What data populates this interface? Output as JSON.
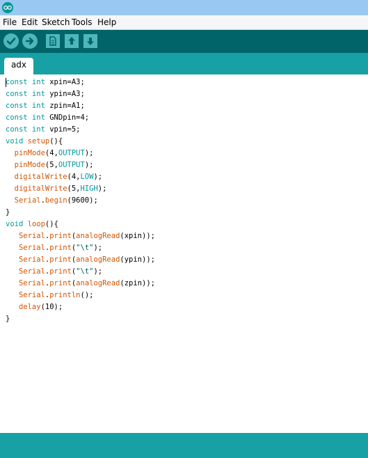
{
  "menu": [
    "File",
    "Edit",
    "Sketch",
    "Tools",
    "Help"
  ],
  "toolbar": {
    "verify_icon": "check-icon",
    "upload_icon": "arrow-right-icon",
    "new_icon": "file-icon",
    "open_icon": "arrow-up-icon",
    "save_icon": "arrow-down-icon"
  },
  "tabs": [
    {
      "label": "adx"
    }
  ],
  "code": [
    [
      {
        "t": "const int",
        "c": "kw"
      },
      {
        "t": " xpin=A3;",
        "c": ""
      }
    ],
    [
      {
        "t": "const int",
        "c": "kw"
      },
      {
        "t": " ypin=A3;",
        "c": ""
      }
    ],
    [
      {
        "t": "const int",
        "c": "kw"
      },
      {
        "t": " zpin=A1;",
        "c": ""
      }
    ],
    [
      {
        "t": "const int",
        "c": "kw"
      },
      {
        "t": " GNDpin=4;",
        "c": ""
      }
    ],
    [
      {
        "t": "const int",
        "c": "kw"
      },
      {
        "t": " vpin=5;",
        "c": ""
      }
    ],
    [
      {
        "t": "void",
        "c": "kw"
      },
      {
        "t": " ",
        "c": ""
      },
      {
        "t": "setup",
        "c": "fn"
      },
      {
        "t": "(){",
        "c": ""
      }
    ],
    [
      {
        "t": "  ",
        "c": ""
      },
      {
        "t": "pinMode",
        "c": "fn"
      },
      {
        "t": "(4,",
        "c": ""
      },
      {
        "t": "OUTPUT",
        "c": "kw"
      },
      {
        "t": ");",
        "c": ""
      }
    ],
    [
      {
        "t": "  ",
        "c": ""
      },
      {
        "t": "pinMode",
        "c": "fn"
      },
      {
        "t": "(5,",
        "c": ""
      },
      {
        "t": "OUTPUT",
        "c": "kw"
      },
      {
        "t": ");",
        "c": ""
      }
    ],
    [
      {
        "t": "  ",
        "c": ""
      },
      {
        "t": "digitalWrite",
        "c": "fn"
      },
      {
        "t": "(4,",
        "c": ""
      },
      {
        "t": "LOW",
        "c": "kw"
      },
      {
        "t": ");",
        "c": ""
      }
    ],
    [
      {
        "t": "  ",
        "c": ""
      },
      {
        "t": "digitalWrite",
        "c": "fn"
      },
      {
        "t": "(5,",
        "c": ""
      },
      {
        "t": "HIGH",
        "c": "kw"
      },
      {
        "t": ");",
        "c": ""
      }
    ],
    [
      {
        "t": "  ",
        "c": ""
      },
      {
        "t": "Serial",
        "c": "fn"
      },
      {
        "t": ".",
        "c": ""
      },
      {
        "t": "begin",
        "c": "fn"
      },
      {
        "t": "(9600);",
        "c": ""
      }
    ],
    [
      {
        "t": "}",
        "c": ""
      }
    ],
    [
      {
        "t": "void",
        "c": "kw"
      },
      {
        "t": " ",
        "c": ""
      },
      {
        "t": "loop",
        "c": "fn"
      },
      {
        "t": "(){",
        "c": ""
      }
    ],
    [
      {
        "t": "   ",
        "c": ""
      },
      {
        "t": "Serial",
        "c": "fn"
      },
      {
        "t": ".",
        "c": ""
      },
      {
        "t": "print",
        "c": "fn"
      },
      {
        "t": "(",
        "c": ""
      },
      {
        "t": "analogRead",
        "c": "fn"
      },
      {
        "t": "(xpin));",
        "c": ""
      }
    ],
    [
      {
        "t": "   ",
        "c": ""
      },
      {
        "t": "Serial",
        "c": "fn"
      },
      {
        "t": ".",
        "c": ""
      },
      {
        "t": "print",
        "c": "fn"
      },
      {
        "t": "(",
        "c": ""
      },
      {
        "t": "\"\\t\"",
        "c": "str"
      },
      {
        "t": ");",
        "c": ""
      }
    ],
    [
      {
        "t": "   ",
        "c": ""
      },
      {
        "t": "Serial",
        "c": "fn"
      },
      {
        "t": ".",
        "c": ""
      },
      {
        "t": "print",
        "c": "fn"
      },
      {
        "t": "(",
        "c": ""
      },
      {
        "t": "analogRead",
        "c": "fn"
      },
      {
        "t": "(ypin));",
        "c": ""
      }
    ],
    [
      {
        "t": "   ",
        "c": ""
      },
      {
        "t": "Serial",
        "c": "fn"
      },
      {
        "t": ".",
        "c": ""
      },
      {
        "t": "print",
        "c": "fn"
      },
      {
        "t": "(",
        "c": ""
      },
      {
        "t": "\"\\t\"",
        "c": "str"
      },
      {
        "t": ");",
        "c": ""
      }
    ],
    [
      {
        "t": "   ",
        "c": ""
      },
      {
        "t": "Serial",
        "c": "fn"
      },
      {
        "t": ".",
        "c": ""
      },
      {
        "t": "print",
        "c": "fn"
      },
      {
        "t": "(",
        "c": ""
      },
      {
        "t": "analogRead",
        "c": "fn"
      },
      {
        "t": "(zpin));",
        "c": ""
      }
    ],
    [
      {
        "t": "   ",
        "c": ""
      },
      {
        "t": "Serial",
        "c": "fn"
      },
      {
        "t": ".",
        "c": ""
      },
      {
        "t": "println",
        "c": "fn"
      },
      {
        "t": "();",
        "c": ""
      }
    ],
    [
      {
        "t": "   ",
        "c": ""
      },
      {
        "t": "delay",
        "c": "fn"
      },
      {
        "t": "(10);",
        "c": ""
      }
    ],
    [
      {
        "t": "}",
        "c": ""
      }
    ]
  ],
  "colors": {
    "toolbar_bg": "#006468",
    "tabbar_bg": "#17a1a5",
    "button_bg": "#4db7bb",
    "keyword": "#00979c",
    "function": "#d35400"
  }
}
